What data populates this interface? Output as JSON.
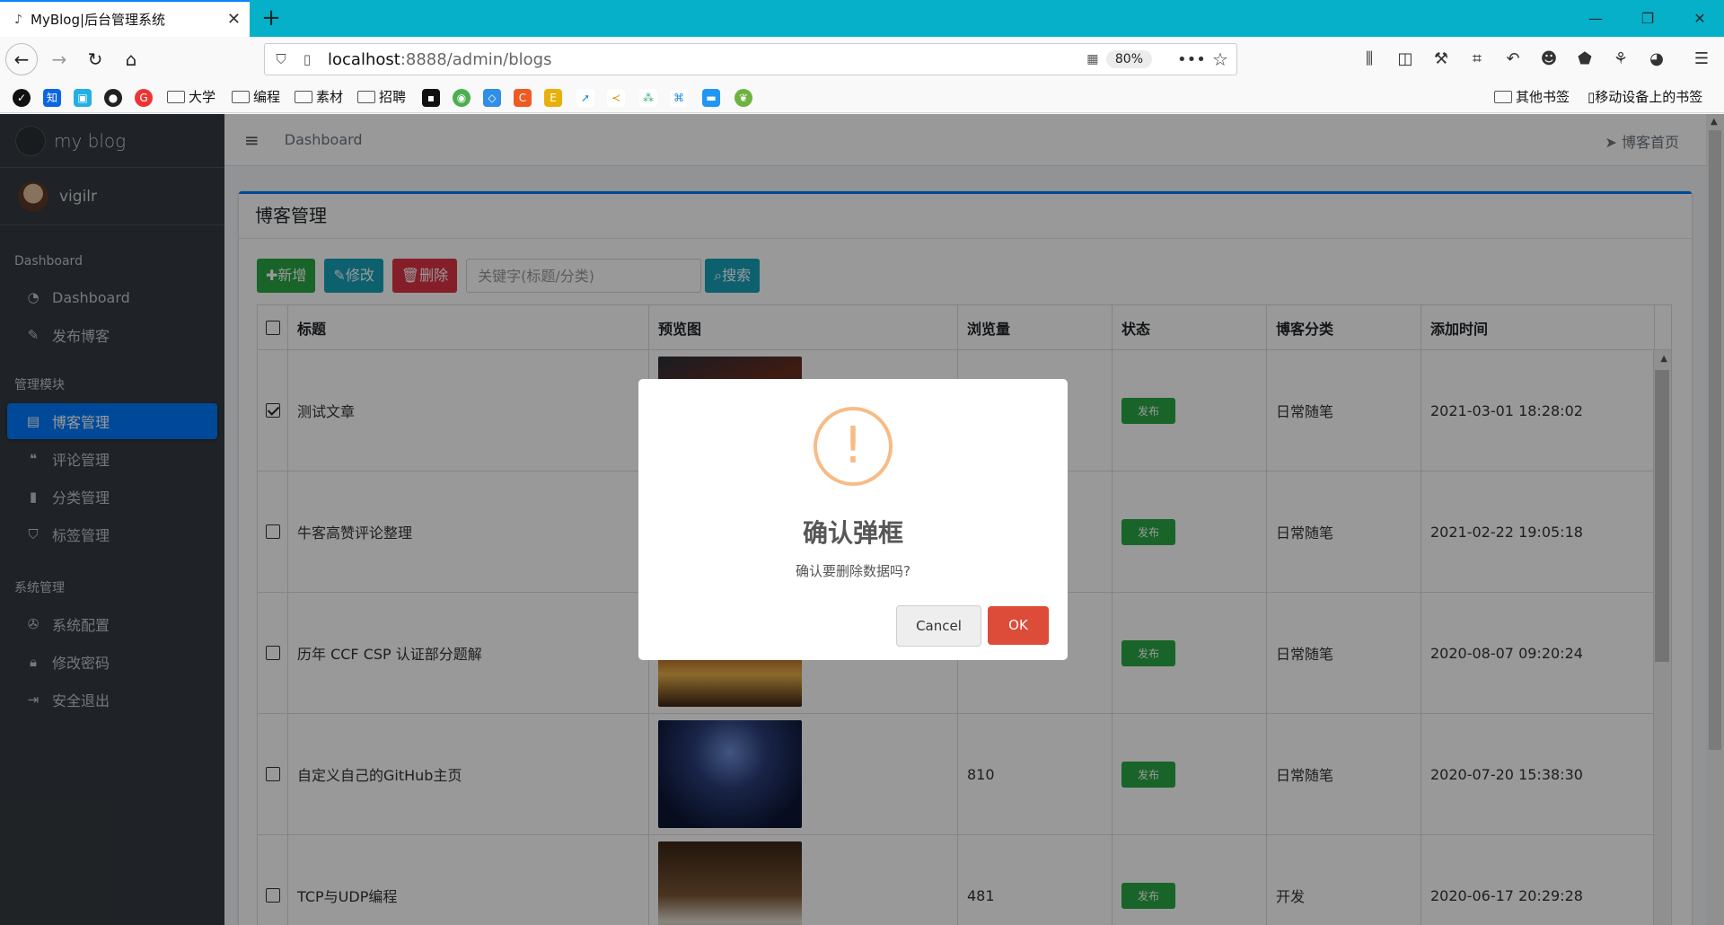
{
  "browser": {
    "tab_title": "MyBlog|后台管理系统",
    "url_host": "localhost",
    "url_rest": ":8888/admin/blogs",
    "zoom": "80%",
    "bookmarks": [
      "大学",
      "编程",
      "素材",
      "招聘"
    ],
    "bookmark_right": [
      "其他书签",
      "移动设备上的书签"
    ]
  },
  "sidebar": {
    "brand": "my blog",
    "user": "vigilr",
    "sections": [
      {
        "header": "Dashboard",
        "items": [
          "Dashboard",
          "发布博客"
        ]
      },
      {
        "header": "管理模块",
        "items": [
          "博客管理",
          "评论管理",
          "分类管理",
          "标签管理"
        ]
      },
      {
        "header": "系统管理",
        "items": [
          "系统配置",
          "修改密码",
          "安全退出"
        ]
      }
    ]
  },
  "topbar": {
    "breadcrumb": "Dashboard",
    "home_link": "博客首页"
  },
  "card": {
    "title": "博客管理",
    "btn_add": "新增",
    "btn_edit": "修改",
    "btn_delete": "删除",
    "search_placeholder": "关键字(标题/分类)",
    "btn_search": "搜索"
  },
  "table": {
    "headers": [
      "标题",
      "预览图",
      "浏览量",
      "状态",
      "博客分类",
      "添加时间"
    ],
    "rows": [
      {
        "checked": true,
        "title": "测试文章",
        "views": "",
        "status": "发布",
        "category": "日常随笔",
        "time": "2021-03-01 18:28:02"
      },
      {
        "checked": false,
        "title": "牛客高赞评论整理",
        "views": "",
        "status": "发布",
        "category": "日常随笔",
        "time": "2021-02-22 19:05:18"
      },
      {
        "checked": false,
        "title": "历年 CCF CSP 认证部分题解",
        "views": "",
        "status": "发布",
        "category": "日常随笔",
        "time": "2020-08-07 09:20:24"
      },
      {
        "checked": false,
        "title": "自定义自己的GitHub主页",
        "views": "810",
        "status": "发布",
        "category": "日常随笔",
        "time": "2020-07-20 15:38:30"
      },
      {
        "checked": false,
        "title": "TCP与UDP编程",
        "views": "481",
        "status": "发布",
        "category": "开发",
        "time": "2020-06-17 20:29:28"
      }
    ]
  },
  "modal": {
    "icon": "!",
    "title": "确认弹框",
    "text": "确认要删除数据吗?",
    "cancel": "Cancel",
    "ok": "OK"
  }
}
